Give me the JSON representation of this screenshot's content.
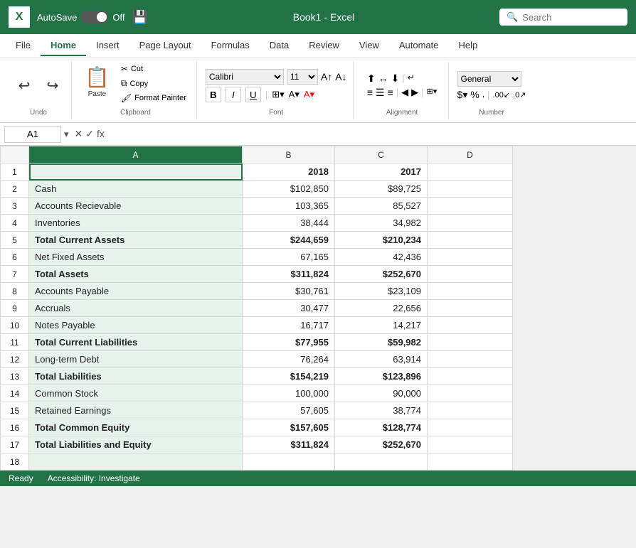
{
  "titleBar": {
    "logo": "X",
    "autosave": "AutoSave",
    "toggle": "Off",
    "save_icon": "💾",
    "filename": "Book1 - Excel",
    "search_placeholder": "Search"
  },
  "ribbon": {
    "tabs": [
      "File",
      "Home",
      "Insert",
      "Page Layout",
      "Formulas",
      "Data",
      "Review",
      "View",
      "Automate",
      "Help"
    ],
    "active_tab": "Home",
    "groups": {
      "undo_label": "Undo",
      "clipboard_label": "Clipboard",
      "font_label": "Font",
      "alignment_label": "Alignment",
      "number_label": "Number"
    },
    "font_name": "Calibri",
    "font_size": "11",
    "number_format": "General"
  },
  "formulaBar": {
    "cell_ref": "A1",
    "formula": ""
  },
  "columns": [
    "",
    "A",
    "B",
    "C",
    "D"
  ],
  "headers": {
    "col_b": "2018",
    "col_c": "2017"
  },
  "rows": [
    {
      "num": 1,
      "a": "",
      "b": "2018",
      "c": "2017",
      "d": "",
      "bold": true,
      "a_selected": true
    },
    {
      "num": 2,
      "a": "Cash",
      "b": "$102,850",
      "c": "$89,725",
      "d": ""
    },
    {
      "num": 3,
      "a": "Accounts Recievable",
      "b": "103,365",
      "c": "85,527",
      "d": ""
    },
    {
      "num": 4,
      "a": "Inventories",
      "b": "38,444",
      "c": "34,982",
      "d": ""
    },
    {
      "num": 5,
      "a": "Total Current Assets",
      "b": "$244,659",
      "c": "$210,234",
      "d": "",
      "bold": true
    },
    {
      "num": 6,
      "a": "Net Fixed Assets",
      "b": "67,165",
      "c": "42,436",
      "d": ""
    },
    {
      "num": 7,
      "a": "Total Assets",
      "b": "$311,824",
      "c": "$252,670",
      "d": "",
      "bold": true
    },
    {
      "num": 8,
      "a": "Accounts Payable",
      "b": "$30,761",
      "c": "$23,109",
      "d": ""
    },
    {
      "num": 9,
      "a": "Accruals",
      "b": "30,477",
      "c": "22,656",
      "d": ""
    },
    {
      "num": 10,
      "a": "Notes Payable",
      "b": "16,717",
      "c": "14,217",
      "d": ""
    },
    {
      "num": 11,
      "a": "Total Current Liabilities",
      "b": "$77,955",
      "c": "$59,982",
      "d": "",
      "bold": true
    },
    {
      "num": 12,
      "a": "Long-term Debt",
      "b": "76,264",
      "c": "63,914",
      "d": ""
    },
    {
      "num": 13,
      "a": "Total Liabilities",
      "b": "$154,219",
      "c": "$123,896",
      "d": "",
      "bold": true
    },
    {
      "num": 14,
      "a": "Common Stock",
      "b": "100,000",
      "c": "90,000",
      "d": ""
    },
    {
      "num": 15,
      "a": "Retained Earnings",
      "b": "57,605",
      "c": "38,774",
      "d": ""
    },
    {
      "num": 16,
      "a": "Total Common Equity",
      "b": "$157,605",
      "c": "$128,774",
      "d": "",
      "bold": true
    },
    {
      "num": 17,
      "a": "Total Liabilities and Equity",
      "b": "$311,824",
      "c": "$252,670",
      "d": "",
      "bold": true
    },
    {
      "num": 18,
      "a": "",
      "b": "",
      "c": "",
      "d": ""
    }
  ]
}
